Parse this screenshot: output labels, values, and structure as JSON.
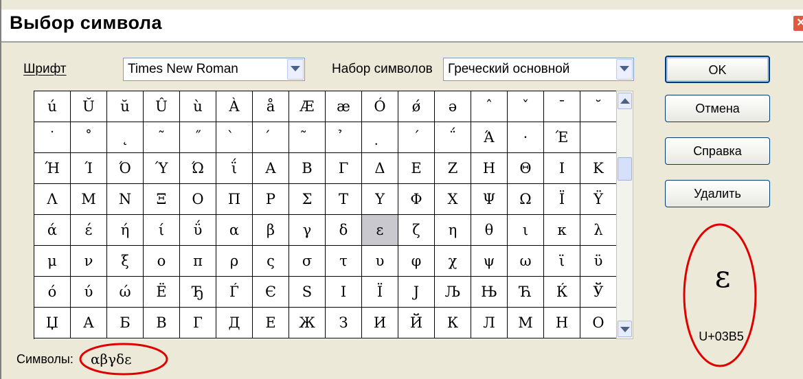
{
  "title": "Выбор символа",
  "font": {
    "label": "Шрифт",
    "value": "Times New Roman"
  },
  "charset": {
    "label": "Набор символов",
    "value": "Греческий основной"
  },
  "buttons": {
    "ok": "OK",
    "cancel": "Отмена",
    "help": "Справка",
    "delete": "Удалить"
  },
  "grid": [
    [
      "ú",
      "Ŭ",
      "ŭ",
      "Û",
      "ù",
      "À",
      "å",
      "Æ",
      "æ",
      "Ó",
      "ǿ",
      "ə",
      "ˆ",
      "ˇ",
      "ˉ",
      "˘"
    ],
    [
      "˙",
      "˚",
      "˛",
      "˜",
      "˝",
      "̀",
      "́",
      "̃",
      "̉",
      "̣",
      "΄",
      "΅",
      "Ά",
      "·",
      "Έ"
    ],
    [
      "Ή",
      "Ί",
      "Ό",
      "Ύ",
      "Ώ",
      "ΐ",
      "Α",
      "Β",
      "Γ",
      "Δ",
      "Ε",
      "Ζ",
      "Η",
      "Θ",
      "Ι",
      "Κ"
    ],
    [
      "Λ",
      "Μ",
      "Ν",
      "Ξ",
      "Ο",
      "Π",
      "Ρ",
      "Σ",
      "Τ",
      "Υ",
      "Φ",
      "Χ",
      "Ψ",
      "Ω",
      "Ϊ",
      "Ϋ"
    ],
    [
      "ά",
      "έ",
      "ή",
      "ί",
      "ΰ",
      "α",
      "β",
      "γ",
      "δ",
      "ε",
      "ζ",
      "η",
      "θ",
      "ι",
      "κ",
      "λ"
    ],
    [
      "μ",
      "ν",
      "ξ",
      "ο",
      "π",
      "ρ",
      "ς",
      "σ",
      "τ",
      "υ",
      "φ",
      "χ",
      "ψ",
      "ω",
      "ϊ",
      "ϋ"
    ],
    [
      "ό",
      "ύ",
      "ώ",
      "Ё",
      "Ђ",
      "Ѓ",
      "Є",
      "Ѕ",
      "І",
      "Ї",
      "Ј",
      "Љ",
      "Њ",
      "Ћ",
      "Ќ",
      "Ў"
    ],
    [
      "Џ",
      "А",
      "Б",
      "В",
      "Г",
      "Д",
      "Е",
      "Ж",
      "З",
      "И",
      "Й",
      "К",
      "Л",
      "М",
      "Н",
      "О"
    ]
  ],
  "selected_char": "ε",
  "selected_code": "U+03B5",
  "symbols": {
    "label": "Символы:",
    "value": "αβγδε"
  },
  "colors": {
    "annotation": "#e00000",
    "selection": "#c8c8ce"
  },
  "icons": {
    "close": "close-icon",
    "dropdown": "chevron-down-icon"
  }
}
